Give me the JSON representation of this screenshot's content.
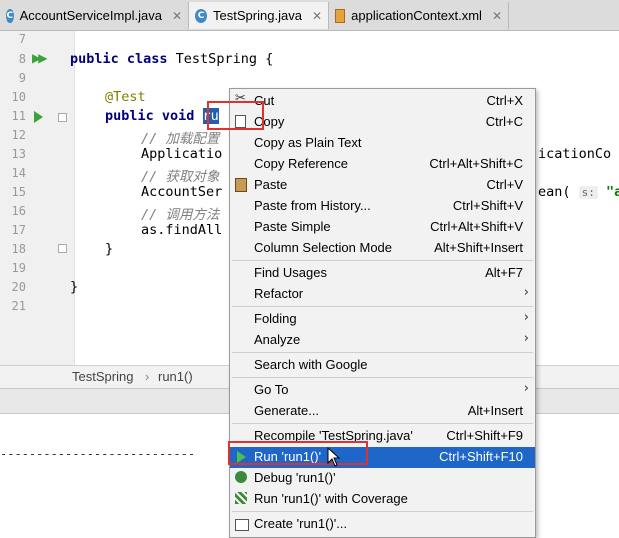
{
  "tabs": [
    {
      "label": "AccountServiceImpl.java",
      "icon": "java-class-icon"
    },
    {
      "label": "TestSpring.java",
      "icon": "java-class-icon",
      "active": true
    },
    {
      "label": "applicationContext.xml",
      "icon": "xml-file-icon"
    }
  ],
  "tab_close": "✕",
  "editor": {
    "line_numbers": [
      "7",
      "8",
      "9",
      "10",
      "11",
      "12",
      "13",
      "14",
      "15",
      "16",
      "17",
      "18",
      "19",
      "20",
      "21"
    ],
    "lines": {
      "l8": {
        "kw": "public class",
        "rest": " TestSpring {"
      },
      "l10": "@Test",
      "l11": {
        "kw": "public void",
        "sel": "ru"
      },
      "l12": "// 加载配置",
      "l13": "Applicatio",
      "l13_tail": "icationCo",
      "l14": "// 获取对象",
      "l15": "AccountSer",
      "l15_tail": "ean(",
      "l15_hint": "s:",
      "l15_str": "\"ac",
      "l16": "// 调用方法",
      "l17": "as.findAll",
      "l18": "}",
      "l20": "}"
    }
  },
  "breadcrumb": [
    "TestSpring",
    "run1()"
  ],
  "breadcrumb_sep": "›",
  "console_dashes": "---------------------------",
  "menu": {
    "items": [
      {
        "label": "Cut",
        "shortcut": "Ctrl+X",
        "icon": "scissors-icon"
      },
      {
        "label": "Copy",
        "shortcut": "Ctrl+C",
        "icon": "copy-icon"
      },
      {
        "label": "Copy as Plain Text",
        "shortcut": ""
      },
      {
        "label": "Copy Reference",
        "shortcut": "Ctrl+Alt+Shift+C"
      },
      {
        "label": "Paste",
        "shortcut": "Ctrl+V",
        "icon": "clipboard-icon"
      },
      {
        "label": "Paste from History...",
        "shortcut": "Ctrl+Shift+V"
      },
      {
        "label": "Paste Simple",
        "shortcut": "Ctrl+Alt+Shift+V"
      },
      {
        "label": "Column Selection Mode",
        "shortcut": "Alt+Shift+Insert"
      },
      {
        "label": "Find Usages",
        "shortcut": "Alt+F7"
      },
      {
        "label": "Refactor",
        "submenu": true
      },
      {
        "label": "Folding",
        "submenu": true
      },
      {
        "label": "Analyze",
        "submenu": true
      },
      {
        "label": "Search with Google",
        "shortcut": ""
      },
      {
        "label": "Go To",
        "submenu": true
      },
      {
        "label": "Generate...",
        "shortcut": "Alt+Insert"
      },
      {
        "label": "Recompile 'TestSpring.java'",
        "shortcut": "Ctrl+Shift+F9"
      },
      {
        "label": "Run 'run1()'",
        "shortcut": "Ctrl+Shift+F10",
        "icon": "run-icon",
        "highlighted": true
      },
      {
        "label": "Debug 'run1()'",
        "shortcut": "",
        "icon": "debug-icon"
      },
      {
        "label": "Run 'run1()' with Coverage",
        "shortcut": "",
        "icon": "coverage-icon"
      },
      {
        "label": "Create 'run1()'...",
        "shortcut": "",
        "icon": "create-config-icon"
      }
    ],
    "submenu_arrow": "›"
  },
  "colors": {
    "highlight": "#1e66c8",
    "annotation_box": "#e03030",
    "run_green": "#3aa33a"
  }
}
